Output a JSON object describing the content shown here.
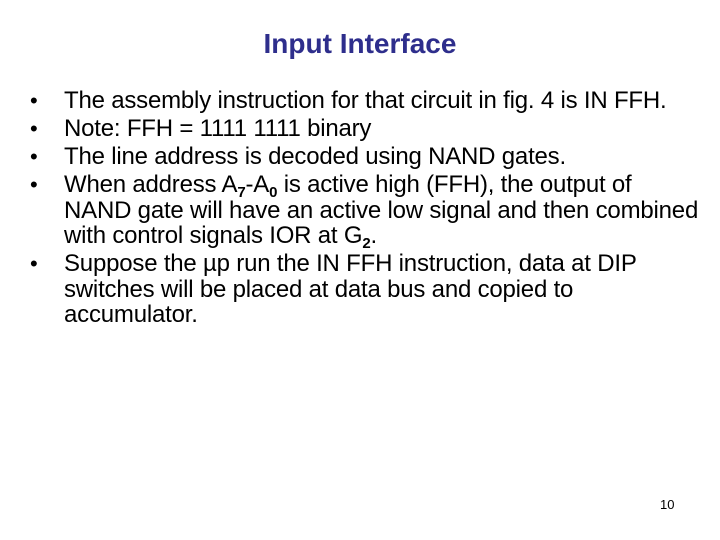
{
  "slide": {
    "title": "Input Interface",
    "bullets": [
      {
        "text": "The assembly instruction for that circuit in fig. 4 is IN FFH."
      },
      {
        "text": "Note: FFH = 1111 1111 binary"
      },
      {
        "text": "The line address is decoded using NAND gates."
      },
      {
        "pre": "When address A",
        "sub1": "7",
        "mid": "-A",
        "sub2": "0",
        "post": " is active high (FFH), the output of NAND gate will have an active low signal and then combined with control signals IOR at G",
        "sub3": "2",
        "end": "."
      },
      {
        "text": "Suppose the µp run the IN FFH instruction, data at DIP switches will be placed at data bus and copied to accumulator."
      }
    ],
    "bullet_glyph": "•",
    "page_number": "10"
  }
}
